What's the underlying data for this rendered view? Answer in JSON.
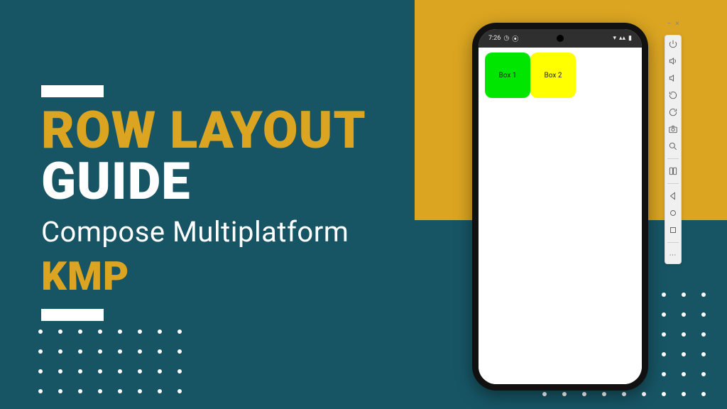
{
  "colors": {
    "bg_teal": "#175565",
    "accent_yellow": "#dba521",
    "box_green": "#00e600",
    "box_yellow": "#ffff00"
  },
  "title": {
    "line1": "ROW LAYOUT",
    "line2": "GUIDE",
    "subtitle": "Compose Multiplatform",
    "tag": "KMP"
  },
  "phone": {
    "status": {
      "time": "7:26",
      "clock_icon": "◷",
      "debug_icon": "⦿",
      "wifi_icon": "▾",
      "signal_icon": "▴▴",
      "battery_icon": "▮"
    },
    "app": {
      "box1_label": "Box 1",
      "box2_label": "Box 2"
    }
  },
  "emulator_toolbar": {
    "minimize": "−",
    "close": "×",
    "icons": [
      "power",
      "volume-up",
      "volume-down",
      "rotate-left",
      "rotate-right",
      "camera",
      "zoom",
      "fold",
      "back",
      "home",
      "overview"
    ],
    "more": "⋯"
  }
}
